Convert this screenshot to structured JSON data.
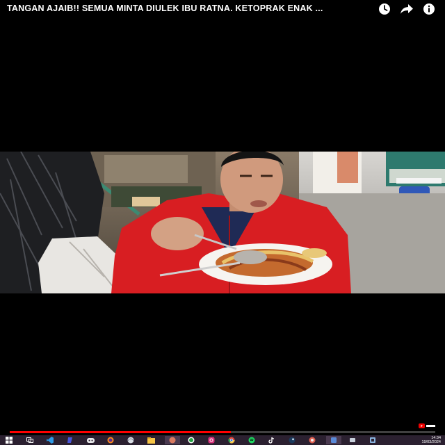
{
  "video": {
    "title": "TANGAN AJAIB!! SEMUA MINTA DIULEK IBU RATNA. KETOPRAK ENAK ...",
    "progress_fraction": 0.52
  },
  "header_icons": [
    "watch-later-icon",
    "share-icon",
    "info-icon"
  ],
  "taskbar": {
    "apps": [
      "windows-start-icon",
      "task-view-icon",
      "vscode-icon",
      "edge-icon",
      "discord-icon",
      "firefox-icon",
      "opera-icon",
      "file-explorer-icon",
      "app-icon",
      "whatsapp-icon",
      "instagram-icon",
      "chrome-icon",
      "spotify-icon",
      "tiktok-icon",
      "steam-icon",
      "chrome-profile-icon",
      "app-icon-2",
      "app-icon-3",
      "app-icon-4"
    ],
    "time": "14:34",
    "date": "19/03/2024"
  }
}
